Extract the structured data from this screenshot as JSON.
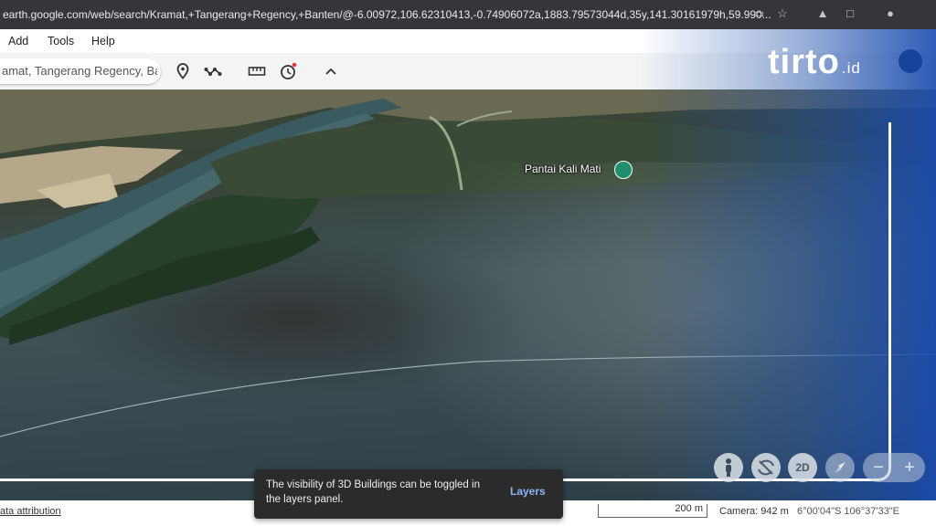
{
  "browser": {
    "url": "earth.google.com/web/search/Kramat,+Tangerang+Regency,+Banten/@-6.00972,106.62310413,-0.74906072a,1883.79573044d,35y,141.30161979h,59.990..."
  },
  "menu": {
    "add": "Add",
    "tools": "Tools",
    "help": "Help"
  },
  "search": {
    "value": "amat, Tangerang Regency, Ban"
  },
  "map": {
    "poi_label": "Pantai Kali Mati"
  },
  "brand": {
    "name": "tirto",
    "suffix": ".id"
  },
  "controls": {
    "view_2d": "2D"
  },
  "toast": {
    "message": "The visibility of 3D Buildings can be toggled in the layers panel.",
    "action": "Layers"
  },
  "status": {
    "attribution": "ata attribution",
    "scale": "200 m",
    "camera": "Camera: 942 m",
    "coordinates": "6°00'04\"S 106°37'33\"E"
  },
  "colors": {
    "brand_blue": "#1f4fb0",
    "poi_green": "#1e8e6e"
  },
  "icons": [
    "cast-icon",
    "star-icon",
    "drive-icon",
    "extension-icon",
    "placemark-icon",
    "path-icon",
    "ruler-icon",
    "history-icon",
    "collapse-icon",
    "pegman-icon",
    "tilt-icon",
    "compass-icon",
    "zoom-out-icon",
    "zoom-in-icon"
  ]
}
